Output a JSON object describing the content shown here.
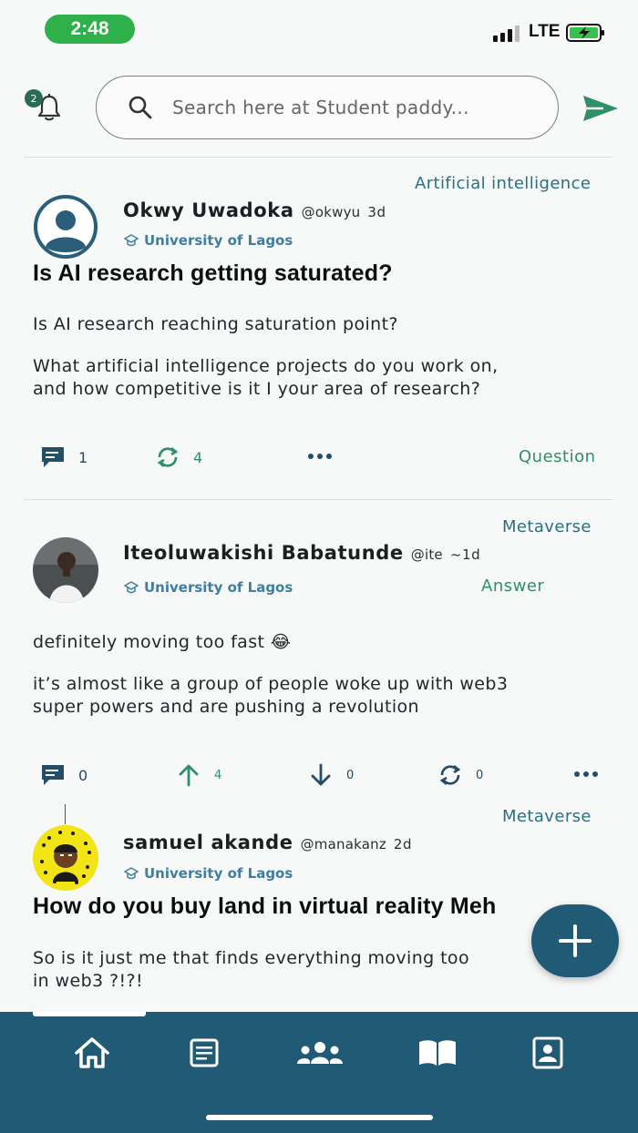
{
  "status_bar": {
    "time": "2:48",
    "network": "LTE"
  },
  "header": {
    "notification_count": "2",
    "search_placeholder": "Search here at Student paddy..."
  },
  "posts": [
    {
      "tag": "Artificial intelligence",
      "author": "Okwy Uwadoka",
      "handle": "@okwyu",
      "age": "3d",
      "university": "University of Lagos",
      "title": "Is AI research getting saturated?",
      "body": [
        "Is AI research reaching saturation point?",
        "What artificial intelligence projects do you work on,",
        "and how competitive is it I your area of research?"
      ],
      "comments": "1",
      "reposts": "4",
      "kind": "Question"
    },
    {
      "tag": "Metaverse",
      "author": "Iteoluwakishi Babatunde",
      "handle": "@ite",
      "age": "~1d",
      "university": "University of Lagos",
      "kind": "Answer",
      "body": [
        "definitely moving too fast 😂",
        "it’s almost like a group of people woke up with web3",
        "super powers and are pushing a revolution"
      ],
      "comments": "0",
      "upvotes": "4",
      "downvotes": "0",
      "reposts": "0"
    },
    {
      "tag": "Metaverse",
      "author": "samuel akande",
      "handle": "@manakanz",
      "age": "2d",
      "university": "University of Lagos",
      "title": "How do you buy land in virtual reality Meh",
      "body": [
        "So is it just me that finds everything moving too",
        "in web3 ?!?!"
      ]
    }
  ],
  "colors": {
    "primary": "#215a74",
    "accent_green": "#2f8f66",
    "link_blue": "#3e7ea0"
  },
  "icons": {
    "tabs": [
      "home-icon",
      "feed-icon",
      "groups-icon",
      "library-icon",
      "profile-icon"
    ],
    "fab": "plus-icon"
  }
}
